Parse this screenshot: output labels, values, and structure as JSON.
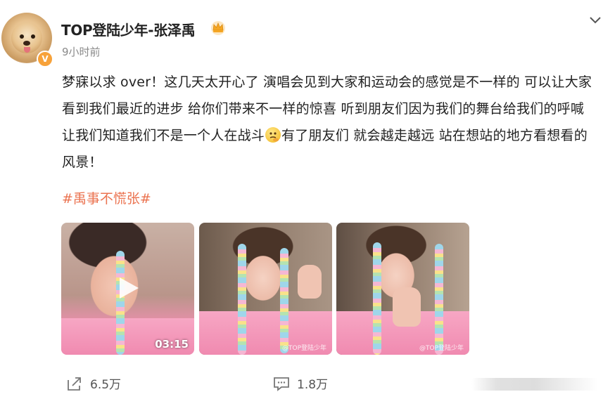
{
  "post": {
    "author": "TOP登陆少年-张泽禹",
    "verified_badge": "V",
    "time": "9小时前",
    "text_part1": "梦寐以求 over！这几天太开心了 演唱会见到大家和运动会的感觉是不一样的 可以让大家看到我们最近的进步 给你们带来不一样的惊喜 听到朋友们因为我们的舞台给我们的呼喊 让我们知道我们不是一个人在战斗",
    "text_part2": "有了朋友们 就会越走越远 站在想站的地方看想看的风景！",
    "hashtag": "#禹事不慌张#",
    "media": {
      "video_duration": "03:15",
      "watermark": "@TOP登陆少年"
    },
    "actions": {
      "share_count": "6.5万",
      "comment_count": "1.8万"
    }
  },
  "icons": {
    "crown": "crown-icon",
    "chevron": "chevron-down-icon",
    "share": "share-icon",
    "comment": "comment-icon",
    "play": "play-icon"
  },
  "colors": {
    "hashtag": "#eb7350",
    "badge": "#f7a23a"
  }
}
